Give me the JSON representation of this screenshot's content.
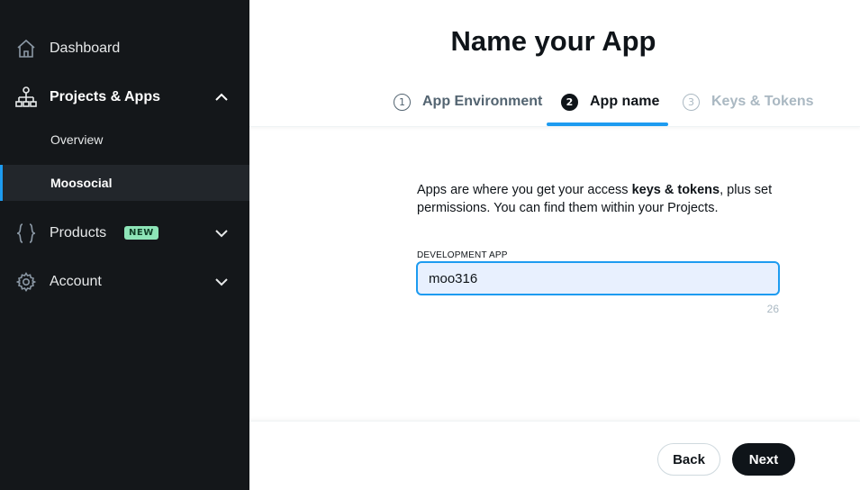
{
  "sidebar": {
    "dashboard": "Dashboard",
    "projects": "Projects & Apps",
    "overview": "Overview",
    "moosocial": "Moosocial",
    "products": "Products",
    "products_badge": "NEW",
    "account": "Account"
  },
  "main": {
    "title": "Name your App",
    "steps": [
      {
        "num": "1",
        "label": "App Environment"
      },
      {
        "num": "2",
        "label": "App name"
      },
      {
        "num": "3",
        "label": "Keys & Tokens"
      }
    ],
    "desc_before": "Apps are where you get your access ",
    "desc_bold": "keys & tokens",
    "desc_after": ", plus set permissions. You can find them within your Projects.",
    "field_label": "DEVELOPMENT APP",
    "field_value": "moo316",
    "counter": "26"
  },
  "footer": {
    "back": "Back",
    "next": "Next"
  },
  "colors": {
    "sidebar_bg": "#14171a",
    "accent": "#1d9bf0",
    "badge_bg": "#8ee5b8"
  }
}
